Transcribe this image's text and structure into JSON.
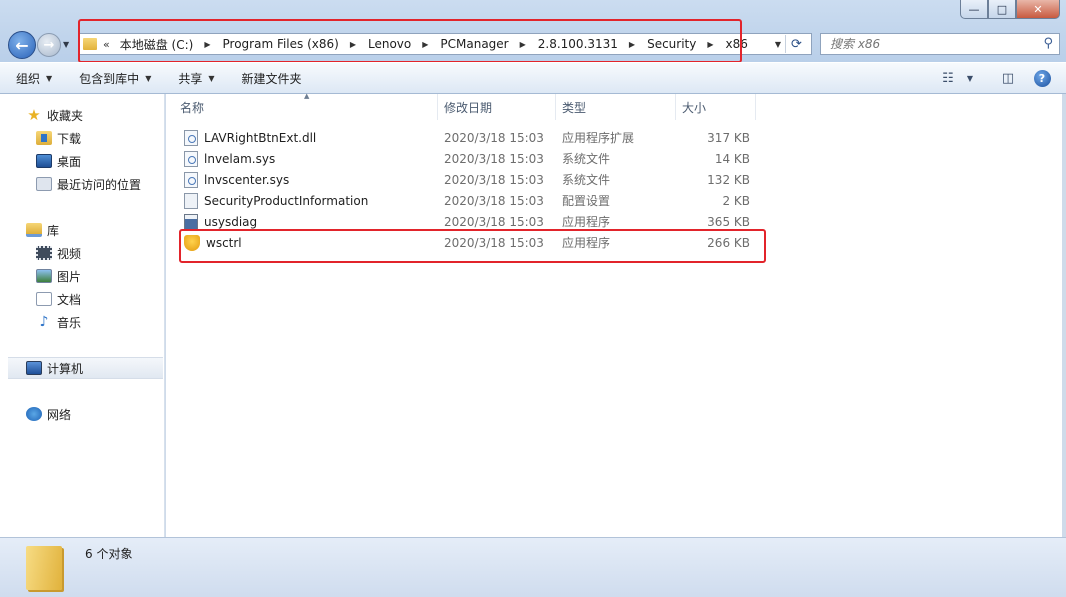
{
  "window": {
    "minimize_glyph": "—",
    "maximize_glyph": "□",
    "close_glyph": "✕"
  },
  "address": {
    "lead": "«",
    "crumbs": [
      "本地磁盘 (C:)",
      "Program Files (x86)",
      "Lenovo",
      "PCManager",
      "2.8.100.3131",
      "Security",
      "x86"
    ]
  },
  "search": {
    "placeholder": "搜索 x86"
  },
  "toolbar": {
    "organize": "组织",
    "include_in_library": "包含到库中",
    "share": "共享",
    "new_folder": "新建文件夹"
  },
  "sidebar": {
    "favorites": "收藏夹",
    "downloads": "下载",
    "desktop": "桌面",
    "recent": "最近访问的位置",
    "libraries": "库",
    "videos": "视频",
    "pictures": "图片",
    "documents": "文档",
    "music": "音乐",
    "computer": "计算机",
    "network": "网络"
  },
  "columns": {
    "name": "名称",
    "date": "修改日期",
    "type": "类型",
    "size": "大小"
  },
  "files": [
    {
      "name": "LAVRightBtnExt.dll",
      "date": "2020/3/18 15:03",
      "type": "应用程序扩展",
      "size": "317 KB",
      "icon": "dll-icon"
    },
    {
      "name": "lnvelam.sys",
      "date": "2020/3/18 15:03",
      "type": "系统文件",
      "size": "14 KB",
      "icon": "sys-file-icon"
    },
    {
      "name": "lnvscenter.sys",
      "date": "2020/3/18 15:03",
      "type": "系统文件",
      "size": "132 KB",
      "icon": "sys-file-icon"
    },
    {
      "name": "SecurityProductInformation",
      "date": "2020/3/18 15:03",
      "type": "配置设置",
      "size": "2 KB",
      "icon": "config-file-icon"
    },
    {
      "name": "usysdiag",
      "date": "2020/3/18 15:03",
      "type": "应用程序",
      "size": "365 KB",
      "icon": "exe-icon"
    },
    {
      "name": "wsctrl",
      "date": "2020/3/18 15:03",
      "type": "应用程序",
      "size": "266 KB",
      "icon": "shield-exe-icon"
    }
  ],
  "status": {
    "count": "6 个对象"
  },
  "colors": {
    "highlight_box": "#e2242b",
    "accent": "#2a62b8"
  }
}
